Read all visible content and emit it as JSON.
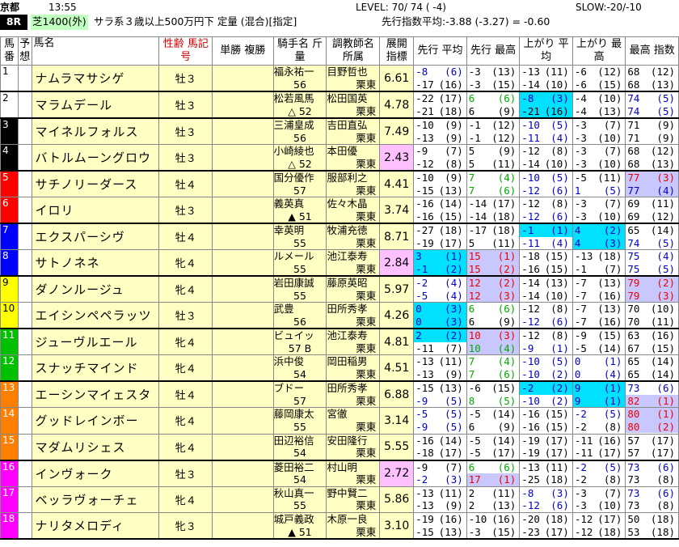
{
  "header": {
    "venue": "京都",
    "time": "13:55",
    "level": "LEVEL: 70/ 74 ( -4)",
    "slow": "SLOW:-20/-10",
    "race": "8R",
    "course": "芝1400(外)",
    "cond": "サラ系３歳以上500万円下 定量 (混合)[指定]",
    "avg": "先行指数平均:-3.88  (-3.27) = -0.60"
  },
  "columns": [
    "馬番",
    "予想",
    "馬名",
    "性齢 馬記号",
    "単勝 複勝",
    "騎手名 斤量",
    "調教師名 所属",
    "展開 指標",
    "先行 平均",
    "先行 最高",
    "上がり 平均",
    "上がり 最高",
    "最高 指数"
  ],
  "colors": {
    "n1": "#ffffff",
    "n2": "#ffffff",
    "n3": "#000000",
    "n4": "#000000",
    "n5": "#ff0000",
    "n6": "#ff0000",
    "n7": "#0000ff",
    "n8": "#0000ff",
    "n9": "#ffff00",
    "n10": "#ffff00",
    "n11": "#00c000",
    "n12": "#00c000",
    "n13": "#ff8000",
    "n14": "#ff8000",
    "n15": "#ff8000",
    "n16": "#ff00ff",
    "n17": "#ff00ff",
    "n18": "#ff00ff",
    "yellow": "#ffffc4",
    "lavender": "#c8c8ff",
    "cyan": "#00e0ff",
    "pink": "#ffc0ff"
  },
  "horses": [
    {
      "n": "1",
      "name": "ナムラマサシゲ",
      "sex": "牡３",
      "jockey": "福永祐一",
      "wt": "56",
      "trainer": "目野哲也",
      "area": "栗東",
      "idx": "6.61",
      "sa": [
        "-8 (6)",
        "-17(16)"
      ],
      "sh": [
        "-3 (13)",
        "-3 (15)"
      ],
      "ua": [
        "-13(11)",
        "-14(10)"
      ],
      "uh": [
        "-6 (12)",
        "-6 (15)"
      ],
      "mx": [
        "68(12)",
        "68(13)"
      ]
    },
    {
      "n": "2",
      "name": "マラムデール",
      "sex": "牡３",
      "jockey": "松若風馬",
      "wt": "△ 52",
      "trainer": "松田国英",
      "area": "栗東",
      "idx": "4.78",
      "sa": [
        "-22(17)",
        "-21(18)"
      ],
      "sh": [
        "6 (6)",
        "6 (9)"
      ],
      "ua": [
        "-8 (3)",
        "-21(16)"
      ],
      "uh": [
        "-4 (10)",
        "-4 (13)"
      ],
      "mx": [
        "74 (5)",
        "74 (5)"
      ]
    },
    {
      "n": "3",
      "name": "マイネルフォルス",
      "sex": "牡３",
      "jockey": "三浦皇成",
      "wt": "56",
      "trainer": "吉田直弘",
      "area": "栗東",
      "idx": "7.49",
      "sa": [
        "-10 (9)",
        "-13 (9)"
      ],
      "sh": [
        "-1 (12)",
        "-1 (12)"
      ],
      "ua": [
        "-10 (5)",
        "-11 (4)"
      ],
      "uh": [
        "-3 (7)",
        "-3 (10)"
      ],
      "mx": [
        "71 (9)",
        "71 (9)"
      ]
    },
    {
      "n": "4",
      "name": "バトルムーングロウ",
      "sex": "牡３",
      "jockey": "小崎綾也",
      "wt": "△ 52",
      "trainer": "本田優",
      "area": "栗東",
      "idx": "2.43",
      "sa": [
        "-9 (7)",
        "-12 (8)"
      ],
      "sh": [
        "5 (9)",
        "5 (11)"
      ],
      "ua": [
        "-12 (8)",
        "-14 (10)"
      ],
      "uh": [
        "-3 (7)",
        "-3 (10)"
      ],
      "mx": [
        "68(12)",
        "68(13)"
      ]
    },
    {
      "n": "5",
      "name": "サチノリーダース",
      "sex": "牡４",
      "jockey": "国分優作",
      "wt": "57",
      "trainer": "服部利之",
      "area": "栗東",
      "idx": "4.41",
      "sa": [
        "-10 (9)",
        "-15(13)"
      ],
      "sh": [
        "7 (4)",
        "7 (6)"
      ],
      "ua": [
        "-10 (5)",
        "-12 (6)"
      ],
      "uh": [
        "-5 (11)",
        "1 (5)"
      ],
      "mx": [
        "77 (3)",
        "77 (4)"
      ]
    },
    {
      "n": "6",
      "name": "イロリ",
      "sex": "牡３",
      "jockey": "義英真",
      "wt": "▲ 51",
      "trainer": "佐々木晶",
      "area": "栗東",
      "idx": "3.74",
      "sa": [
        "-16(14)",
        "-16(15)"
      ],
      "sh": [
        "-14(17)",
        "-14(18)"
      ],
      "ua": [
        "-12 (8)",
        "-12 (6)"
      ],
      "uh": [
        "-3 (7)",
        "-3 (10)"
      ],
      "mx": [
        "69(11)",
        "69(12)"
      ]
    },
    {
      "n": "7",
      "name": "エクスパーシヴ",
      "sex": "牡４",
      "jockey": "幸英明",
      "wt": "55",
      "trainer": "牧浦充徳",
      "area": "栗東",
      "idx": "8.71",
      "sa": [
        "-27(18)",
        "-19(17)"
      ],
      "sh": [
        "-17(18)",
        "5 (11)"
      ],
      "ua": [
        "-1 (1)",
        "-11 (4)"
      ],
      "uh": [
        "4 (2)",
        "4 (3)"
      ],
      "mx": [
        "65(14)",
        "74 (5)"
      ]
    },
    {
      "n": "8",
      "name": "サトノネネ",
      "sex": "牝４",
      "jockey": "ルメール",
      "wt": "55",
      "trainer": "池江泰寿",
      "area": "栗東",
      "idx": "2.84",
      "sa": [
        "3 (1)",
        "-1 (2)"
      ],
      "sh": [
        "15 (1)",
        "15 (2)"
      ],
      "ua": [
        "-18(15)",
        "-16(15)"
      ],
      "uh": [
        "-13(18)",
        "-1 (7)"
      ],
      "mx": [
        "75 (4)",
        "75 (5)"
      ]
    },
    {
      "n": "9",
      "name": "ダノンルージュ",
      "sex": "牝４",
      "jockey": "岩田康誠",
      "wt": "55",
      "trainer": "藤原英昭",
      "area": "栗東",
      "idx": "5.97",
      "sa": [
        "-2 (4)",
        "-5 (4)"
      ],
      "sh": [
        "12 (2)",
        "12 (3)"
      ],
      "ua": [
        "-14(13)",
        "-14(10)"
      ],
      "uh": [
        "-7 (13)",
        "-7 (16)"
      ],
      "mx": [
        "79 (2)",
        "79 (3)"
      ]
    },
    {
      "n": "10",
      "name": "エイシンペペラッツ",
      "sex": "牡３",
      "jockey": "武豊",
      "wt": "56",
      "trainer": "田所秀孝",
      "area": "栗東",
      "idx": "4.26",
      "sa": [
        "0 (3)",
        "0 (3)"
      ],
      "sh": [
        "6 (6)",
        "6 (9)"
      ],
      "ua": [
        "-12 (8)",
        "-12 (6)"
      ],
      "uh": [
        "-7 (13)",
        "-7 (16)"
      ],
      "mx": [
        "70(10)",
        "70(11)"
      ]
    },
    {
      "n": "11",
      "name": "ジューヴルエール",
      "sex": "牝４",
      "jockey": "ビュイッ",
      "wt": "57 B",
      "trainer": "池江泰寿",
      "area": "栗東",
      "idx": "4.81",
      "sa": [
        "2 (2)",
        "-11 (7)"
      ],
      "sh": [
        "10 (3)",
        "10 (4)"
      ],
      "ua": [
        "-12 (8)",
        "-9 (1)"
      ],
      "uh": [
        "-9 (15)",
        "-5 (14)"
      ],
      "mx": [
        "63(16)",
        "67(15)"
      ]
    },
    {
      "n": "12",
      "name": "スナッチマインド",
      "sex": "牝４",
      "jockey": "浜中俊",
      "wt": "54",
      "trainer": "岡田稲男",
      "area": "栗東",
      "idx": "4.51",
      "sa": [
        "-13(11)",
        "-13 (9)"
      ],
      "sh": [
        "7 (4)",
        "7 (6)"
      ],
      "ua": [
        "-10 (5)",
        "-10 (2)"
      ],
      "uh": [
        "0 (1)",
        "0 (4)"
      ],
      "mx": [
        "65(14)",
        "65(14)"
      ]
    },
    {
      "n": "13",
      "name": "エーシンマイェスタ",
      "sex": "牡４",
      "jockey": "ブドー",
      "wt": "57",
      "trainer": "田所秀孝",
      "area": "栗東",
      "idx": "6.88",
      "sa": [
        "-15(13)",
        "-9 (5)"
      ],
      "sh": [
        "-6 (15)",
        "8 (5)"
      ],
      "ua": [
        "-2 (2)",
        "-10 (2)"
      ],
      "uh": [
        "9 (1)",
        "9 (1)"
      ],
      "mx": [
        "73 (6)",
        "82 (1)"
      ]
    },
    {
      "n": "14",
      "name": "グッドレインボー",
      "sex": "牝４",
      "jockey": "藤岡康太",
      "wt": "55",
      "trainer": "宮徹",
      "area": "栗東",
      "idx": "3.14",
      "sa": [
        "-5 (5)",
        "-9 (5)"
      ],
      "sh": [
        "-5 (14)",
        "6 (9)"
      ],
      "ua": [
        "-16(15)",
        "-16(15)"
      ],
      "uh": [
        "-2 (5)",
        "-2 (8)"
      ],
      "mx": [
        "80 (1)",
        "80 (2)"
      ]
    },
    {
      "n": "15",
      "name": "マダムリシェス",
      "sex": "牝４",
      "jockey": "田辺裕信",
      "wt": "54",
      "trainer": "安田隆行",
      "area": "栗東",
      "idx": "5.55",
      "sa": [
        "-16(14)",
        "-18(17)"
      ],
      "sh": [
        "-5 (14)",
        "-5 (17)"
      ],
      "ua": [
        "-19(17)",
        "-19(17)"
      ],
      "uh": [
        "-11(16)",
        "-11(17)"
      ],
      "mx": [
        "57(17)",
        "57(17)"
      ]
    },
    {
      "n": "16",
      "name": "インヴォーク",
      "sex": "牡３",
      "jockey": "菱田裕二",
      "wt": "54",
      "trainer": "村山明",
      "area": "栗東",
      "idx": "2.72",
      "sa": [
        "-9 (7)",
        "-2 (3)"
      ],
      "sh": [
        "6 (6)",
        "17 (1)"
      ],
      "ua": [
        "-13(11)",
        "-25(18)"
      ],
      "uh": [
        "-2 (5)",
        "-2 (8)"
      ],
      "mx": [
        "73 (6)",
        "73 (8)"
      ]
    },
    {
      "n": "17",
      "name": "ベッラヴォーチェ",
      "sex": "牝４",
      "jockey": "秋山真一",
      "wt": "55",
      "trainer": "野中賢二",
      "area": "栗東",
      "idx": "5.86",
      "sa": [
        "-13(11)",
        "-13 (9)"
      ],
      "sh": [
        "2 (11)",
        "2 (13)"
      ],
      "ua": [
        "-8 (3)",
        "-12 (6)"
      ],
      "uh": [
        "-3 (7)",
        "-3 (10)"
      ],
      "mx": [
        "73 (6)",
        "73 (8)"
      ]
    },
    {
      "n": "18",
      "name": "ナリタメロディ",
      "sex": "牝３",
      "jockey": "城戸義政",
      "wt": "▲ 51",
      "trainer": "木原一良",
      "area": "栗東",
      "idx": "3.10",
      "sa": [
        "-19(16)",
        "-15(13)"
      ],
      "sh": [
        "-10(16)",
        "-3 (15)"
      ],
      "ua": [
        "-20(18)",
        "-23(17)"
      ],
      "uh": [
        "-12(17)",
        "-12(18)"
      ],
      "mx": [
        "50(18)",
        "53(18)"
      ]
    }
  ]
}
